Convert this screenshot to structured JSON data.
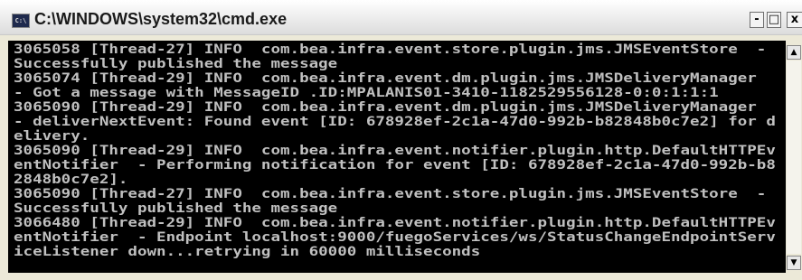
{
  "window": {
    "title": "C:\\WINDOWS\\system32\\cmd.exe",
    "icon": "cmd-icon",
    "icon_label": "C:\\",
    "minimize_label": "-",
    "maximize_label": "□",
    "close_label": "x"
  },
  "console": {
    "background": "#000000",
    "foreground": "#c0c0c0",
    "lines": [
      "3065058 [Thread-27] INFO  com.bea.infra.event.store.plugin.jms.JMSEventStore  -",
      "Successfully published the message",
      "3065074 [Thread-29] INFO  com.bea.infra.event.dm.plugin.jms.JMSDeliveryManager",
      "- Got a message with MessageID .ID:MPALANIS01-3410-1182529556128-0:0:1:1:1",
      "3065090 [Thread-29] INFO  com.bea.infra.event.dm.plugin.jms.JMSDeliveryManager",
      "- deliverNextEvent: Found event [ID: 678928ef-2c1a-47d0-992b-b82848b0c7e2] for d",
      "elivery.",
      "3065090 [Thread-29] INFO  com.bea.infra.event.notifier.plugin.http.DefaultHTTPEv",
      "entNotifier  - Performing notification for event [ID: 678928ef-2c1a-47d0-992b-b8",
      "2848b0c7e2].",
      "3065090 [Thread-27] INFO  com.bea.infra.event.store.plugin.jms.JMSEventStore  -",
      "Successfully published the message",
      "3066480 [Thread-29] INFO  com.bea.infra.event.notifier.plugin.http.DefaultHTTPEv",
      "entNotifier  - Endpoint localhost:9000/fuegoServices/ws/StatusChangeEndpointServ",
      "iceListener down...retrying in 60000 milliseconds"
    ]
  },
  "scrollbar": {
    "up_arrow": "▲",
    "down_arrow": "▼"
  }
}
